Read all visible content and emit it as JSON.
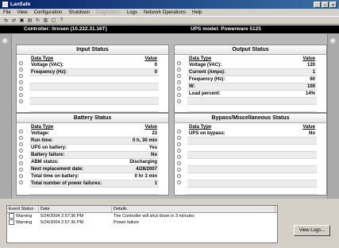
{
  "window": {
    "title": "LanSafe"
  },
  "menu": [
    "File",
    "View",
    "Configuration",
    "Shutdown",
    "Diagnostics",
    "Logs",
    "Network Operations",
    "Help"
  ],
  "menu_disabled": [
    4
  ],
  "toolbar_icons": [
    "connect-icon",
    "disconnect-icon",
    "computer-icon",
    "properties-icon",
    "refresh-icon",
    "battery-icon",
    "save-icon",
    "help-icon"
  ],
  "header": {
    "controller": "Controller:  itrosen (10.222.31.16T)",
    "ups_model": "UPS model:  Powerware 5125"
  },
  "input_status": {
    "title": "Input Status",
    "col_type": "Data Type",
    "col_value": "Value",
    "rows": [
      {
        "label": "Voltage (VAC):",
        "value": "0"
      },
      {
        "label": "Frequency (Hz):",
        "value": "0"
      }
    ]
  },
  "output_status": {
    "title": "Output Status",
    "col_type": "Data Type",
    "col_value": "Value",
    "rows": [
      {
        "label": "Voltage (VAC):",
        "value": "120"
      },
      {
        "label": "Current (Amps):",
        "value": "1"
      },
      {
        "label": "Frequency (Hz):",
        "value": "60"
      },
      {
        "label": "W:",
        "value": "100"
      },
      {
        "label": "Load percent:",
        "value": "14%"
      }
    ]
  },
  "battery_status": {
    "title": "Battery Status",
    "col_type": "Data Type",
    "col_value": "Value",
    "rows": [
      {
        "label": "Voltage:",
        "value": "23"
      },
      {
        "label": "Run time:",
        "value": "0 h, 30 min"
      },
      {
        "label": "UPS on battery:",
        "value": "Yes"
      },
      {
        "label": "Battery failure:",
        "value": "No"
      },
      {
        "label": "ABM status:",
        "value": "Discharging"
      },
      {
        "label": "Next replacement date:",
        "value": "4/28/2007"
      },
      {
        "label": "Total time on battery:",
        "value": "0 hr 3 min"
      },
      {
        "label": "Total number of power failures:",
        "value": "1"
      }
    ]
  },
  "bypass_status": {
    "title": "Bypass/Miscellaneous Status",
    "col_type": "Data Type",
    "col_value": "Value",
    "rows": [
      {
        "label": "UPS on bypass:",
        "value": "No"
      }
    ]
  },
  "events": {
    "columns": [
      "Event Status",
      "Date",
      "Details"
    ],
    "rows": [
      {
        "status": "Warning",
        "date": "5/24/2004 2:57:36 PM",
        "details": "The Controller will shut down in 3 minutes"
      },
      {
        "status": "Warning",
        "date": "5/24/2004 2:57:36 PM",
        "details": "Power failure"
      }
    ]
  },
  "view_logs_label": "View Logs..."
}
